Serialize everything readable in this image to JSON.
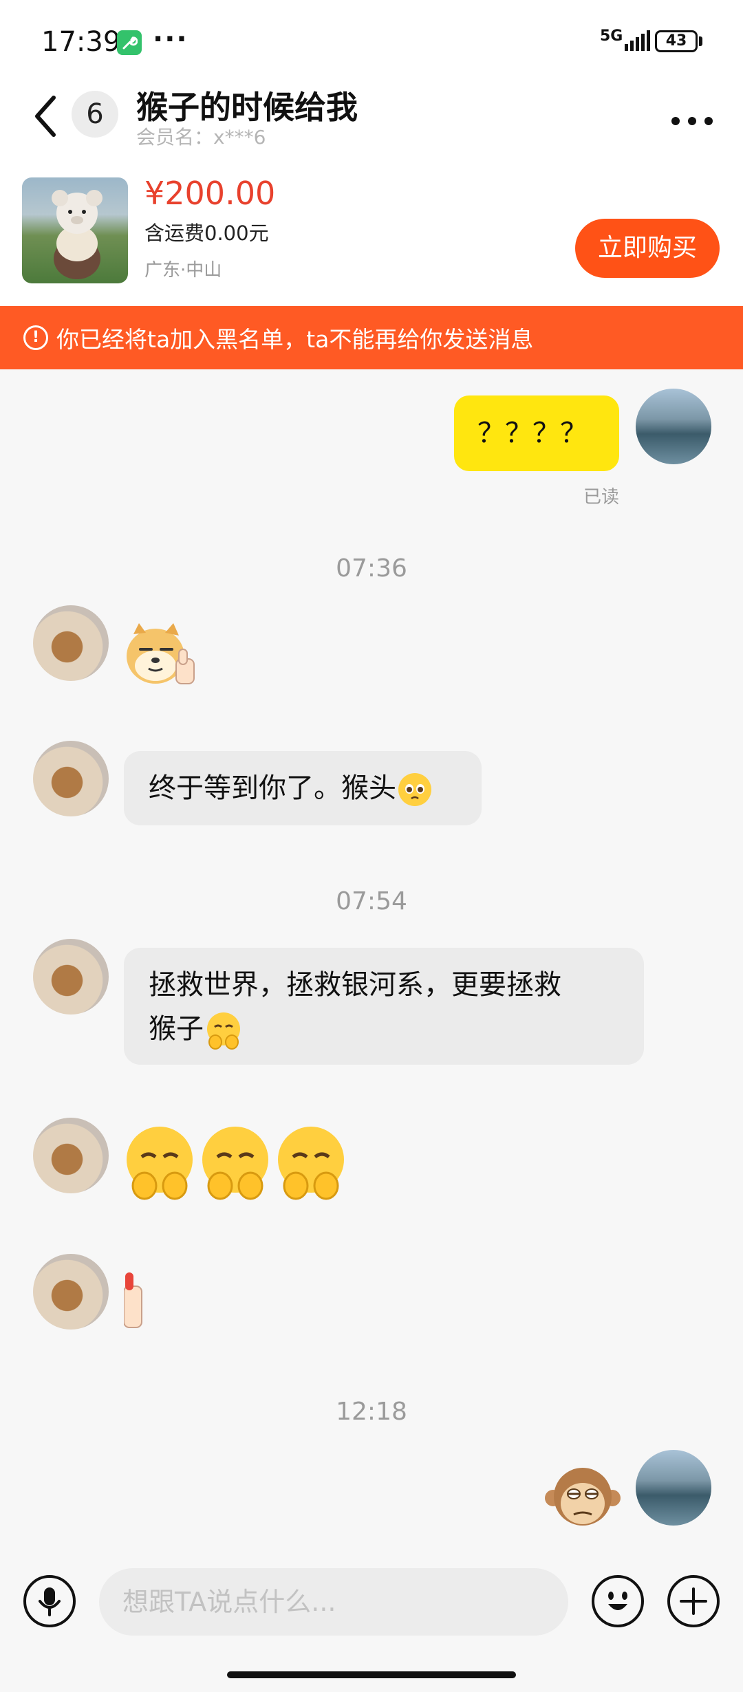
{
  "status_bar": {
    "time": "17:39",
    "dots": "···",
    "network": "5G",
    "battery": "43"
  },
  "header": {
    "unread_count": "6",
    "title": "猴子的时候给我",
    "member_name": "会员名：x***6",
    "more_icon": "ellipsis-icon"
  },
  "product": {
    "price": "¥200.00",
    "shipping": "含运费0.00元",
    "location": "广东·中山",
    "buy_label": "立即购买"
  },
  "banner": {
    "icon": "!",
    "text": "你已经将ta加入黑名单，ta不能再给你发送消息"
  },
  "messages": {
    "self_text_1": "？？？？",
    "read_status": "已读",
    "time_1": "07:36",
    "other_text_1": "终于等到你了。猴头",
    "time_2": "07:54",
    "other_text_2_line1": "拯救世界，拯救银河系，更要拯救",
    "other_text_2_line2": "猴子",
    "time_3": "12:18"
  },
  "input": {
    "placeholder": "想跟TA说点什么..."
  },
  "colors": {
    "accent": "#ff5216",
    "banner": "#ff5a24",
    "self_bubble": "#ffe60f",
    "price": "#e8412d"
  }
}
